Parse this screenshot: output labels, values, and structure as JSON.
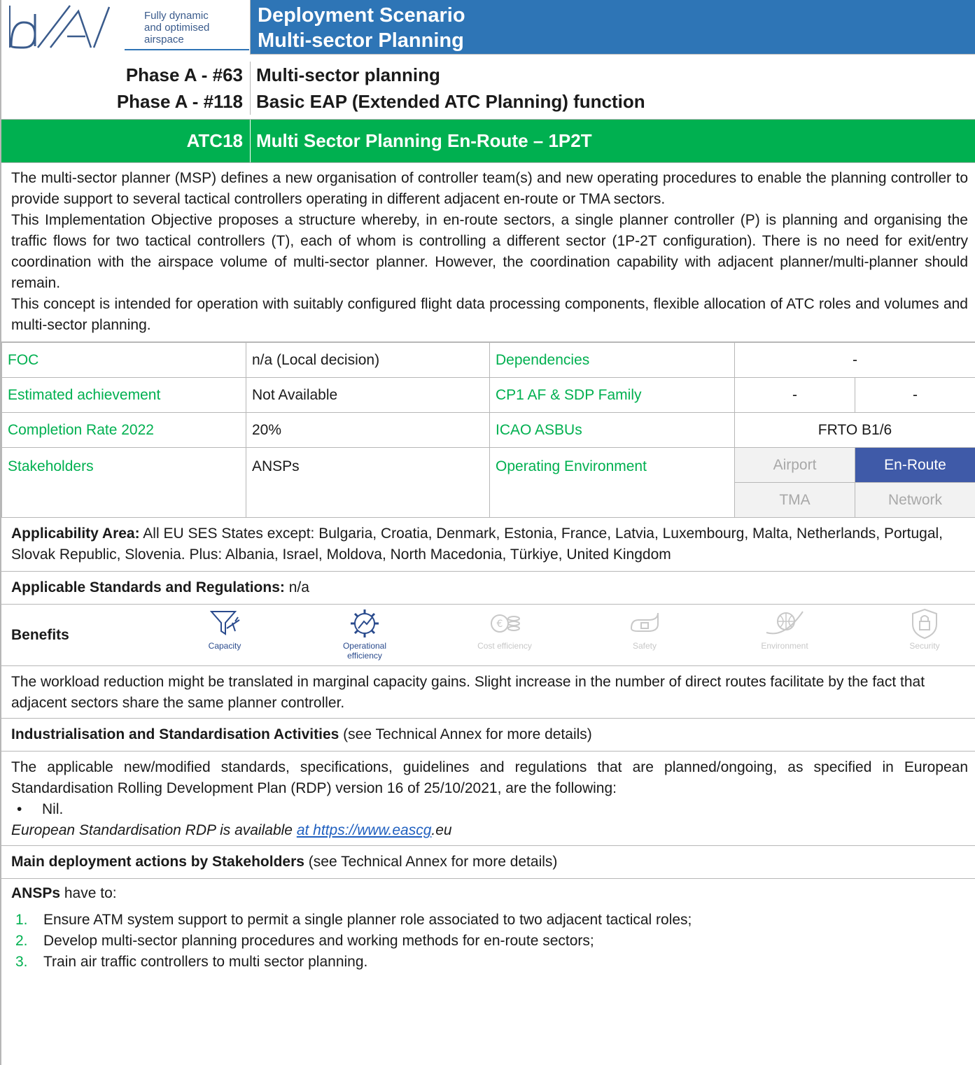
{
  "logo": {
    "letters": "dA",
    "tagline": [
      "Fully dynamic",
      "and optimised",
      "airspace"
    ]
  },
  "header": {
    "title_line1": "Deployment Scenario",
    "title_line2": "Multi-sector Planning"
  },
  "phases": [
    {
      "code": "Phase A - #63",
      "name": "Multi-sector planning"
    },
    {
      "code": "Phase A - #118",
      "name": "Basic EAP (Extended ATC Planning) function"
    }
  ],
  "atc": {
    "code": "ATC18",
    "name": "Multi Sector Planning En-Route – 1P2T"
  },
  "description": [
    "The multi-sector planner (MSP) defines a new organisation of controller team(s) and new operating procedures to enable the planning controller to provide support to several tactical controllers operating in different adjacent en-route or TMA sectors.",
    "This Implementation Objective proposes a structure whereby, in en-route sectors, a single planner controller (P) is planning and organising the traffic flows for two tactical controllers (T), each of whom is controlling a different sector (1P-2T configuration). There is no need for exit/entry coordination with the airspace volume of multi-sector planner. However, the coordination capability with adjacent planner/multi-planner should remain.",
    "This concept is intended for operation with suitably configured flight data processing components, flexible allocation of ATC roles and volumes and multi-sector planning."
  ],
  "info": {
    "foc_label": "FOC",
    "foc_value": "n/a (Local decision)",
    "dep_label": "Dependencies",
    "dep_value": "-",
    "est_label": "Estimated achievement",
    "est_value": "Not Available",
    "cp1_label": "CP1 AF & SDP Family",
    "cp1_value1": "-",
    "cp1_value2": "-",
    "rate_label": "Completion Rate 2022",
    "rate_value": "20%",
    "icao_label": "ICAO ASBUs",
    "icao_value": "FRTO B1/6",
    "stake_label": "Stakeholders",
    "stake_value": "ANSPs",
    "env_label": "Operating Environment",
    "env": {
      "airport": "Airport",
      "enroute": "En-Route",
      "tma": "TMA",
      "network": "Network"
    }
  },
  "applicability": {
    "label": "Applicability Area:",
    "text": " All EU SES States except: Bulgaria, Croatia, Denmark, Estonia, France, Latvia, Luxembourg, Malta, Netherlands, Portugal, Slovak Republic, Slovenia. Plus: Albania, Israel, Moldova, North Macedonia, Türkiye, United Kingdom"
  },
  "standards": {
    "label": "Applicable Standards and Regulations:",
    "text": " n/a"
  },
  "benefits": {
    "label": "Benefits",
    "items": [
      {
        "caption": "Capacity",
        "active": true
      },
      {
        "caption_line1": "Operational",
        "caption_line2": "efficiency",
        "active": true
      },
      {
        "caption": "Cost efficiency",
        "active": false
      },
      {
        "caption": "Safety",
        "active": false
      },
      {
        "caption": "Environment",
        "active": false
      },
      {
        "caption": "Security",
        "active": false
      }
    ],
    "text": "The workload reduction might be translated in marginal capacity gains. Slight increase in the number of direct routes facilitate by the fact that adjacent sectors share the same planner controller."
  },
  "industrialisation": {
    "label": "Industrialisation and Standardisation Activities",
    "note": " (see Technical Annex for more details)",
    "text": "The applicable new/modified standards, specifications, guidelines and regulations that are planned/ongoing, as specified in European Standardisation Rolling Development Plan (RDP) version 16 of 25/10/2021, are the following:",
    "bullet": "Nil.",
    "rdp_prefix": "European Standardisation RDP is available ",
    "rdp_link": "at https://www.eascg",
    "rdp_suffix": ".eu"
  },
  "actions": {
    "label": "Main deployment actions by Stakeholders",
    "note": " (see Technical Annex for more details)",
    "ansps": "ANSPs",
    "ansps_suffix": " have to:",
    "items": [
      {
        "num": "1.",
        "text": "Ensure ATM system support to permit a single planner role associated to two adjacent tactical roles;"
      },
      {
        "num": "2.",
        "text": "Develop multi-sector planning procedures and working methods for en-route sectors;"
      },
      {
        "num": "3.",
        "text": "Train air traffic controllers to multi sector planning."
      }
    ]
  }
}
